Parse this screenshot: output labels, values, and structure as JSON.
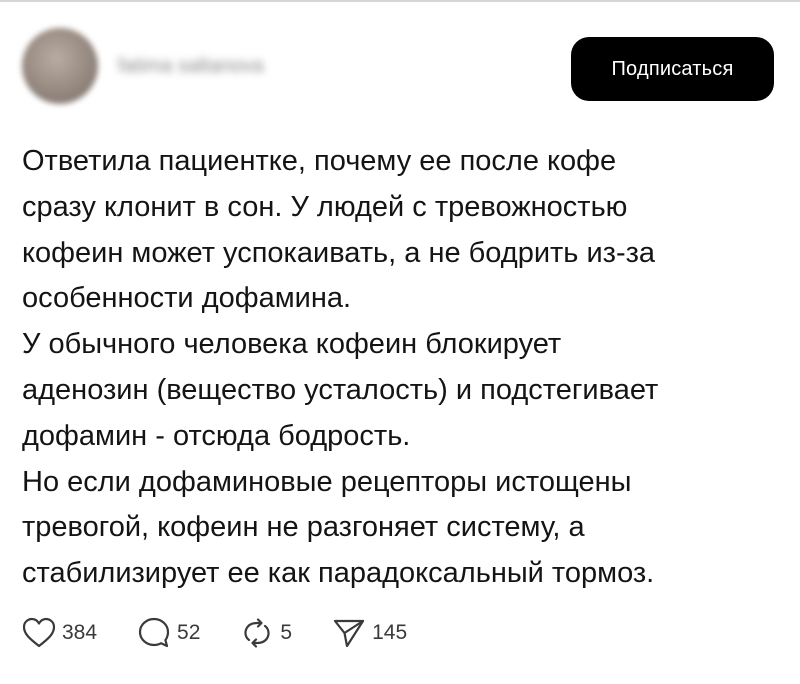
{
  "post": {
    "author_blurred": "fatima saltanova",
    "subscribe_label": "Подписаться",
    "text_lines": [
      "Ответила пациентке, почему ее после кофе",
      "сразу клонит в сон. У людей с тревожностью",
      "кофеин может успокаивать, а не бодрить из-за",
      "особенности дофамина.",
      "У обычного человека кофеин блокирует",
      "аденозин (вещество усталость) и подстегивает",
      "дофамин - отсюда бодрость.",
      "Но если дофаминовые рецепторы истощены",
      "тревогой, кофеин не разгоняет систему, а",
      "стабилизирует ее как парадоксальный тормоз."
    ]
  },
  "actions": {
    "likes": "384",
    "comments": "52",
    "reposts": "5",
    "shares": "145"
  },
  "icons": {
    "like": "heart-icon",
    "comment": "comment-bubble-icon",
    "repost": "repost-icon",
    "share": "send-icon"
  },
  "colors": {
    "button_bg": "#000000",
    "button_text": "#ffffff",
    "text": "#141414",
    "icon": "#3a3a3a"
  }
}
